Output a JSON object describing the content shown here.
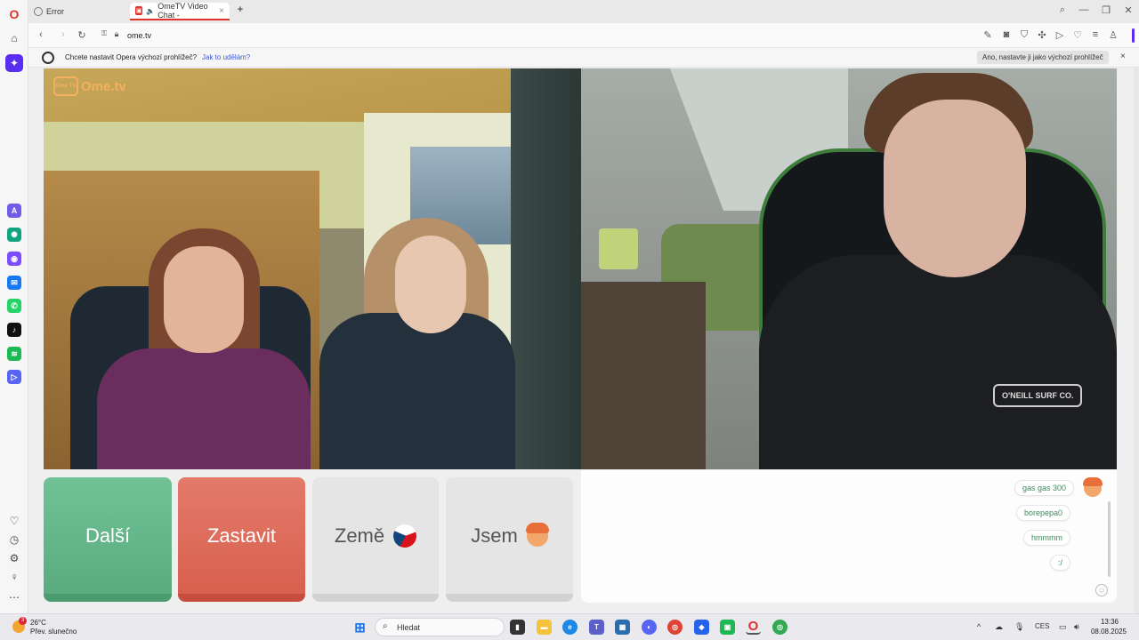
{
  "browser": {
    "tabs": [
      {
        "label": "Error",
        "active": false
      },
      {
        "label": "OmeTV Video Chat -",
        "active": true
      }
    ],
    "new_tab_label": "+",
    "url": "ome.tv",
    "notification": {
      "text": "Chcete nastavit Opera výchozí prohlížeč?",
      "link": "Jak to udělám?",
      "button": "Ano, nastavte ji jako výchozí prohlížeč",
      "close": "×"
    }
  },
  "site": {
    "logo_text": "Ome.tv",
    "logo_box_text": "Ome TV",
    "remote_shirt_text": "O'NEILL SURF CO."
  },
  "controls": {
    "next": "Další",
    "stop": "Zastavit",
    "country": "Země",
    "gender": "Jsem"
  },
  "chat": {
    "messages": [
      "gas gas 300",
      "borepepa0",
      "hmmmm",
      ":/"
    ]
  },
  "taskbar": {
    "weather_badge": "3",
    "weather_temp": "26°C",
    "weather_desc": "Přev. slunečno",
    "search_placeholder": "Hledat",
    "language": "CES",
    "time": "13:36",
    "date": "08.08.2025"
  },
  "colors": {
    "next_button": "#6cbf92",
    "stop_button": "#e0705f",
    "opera_red": "#e2322b",
    "chat_text": "#3f8a5c"
  }
}
